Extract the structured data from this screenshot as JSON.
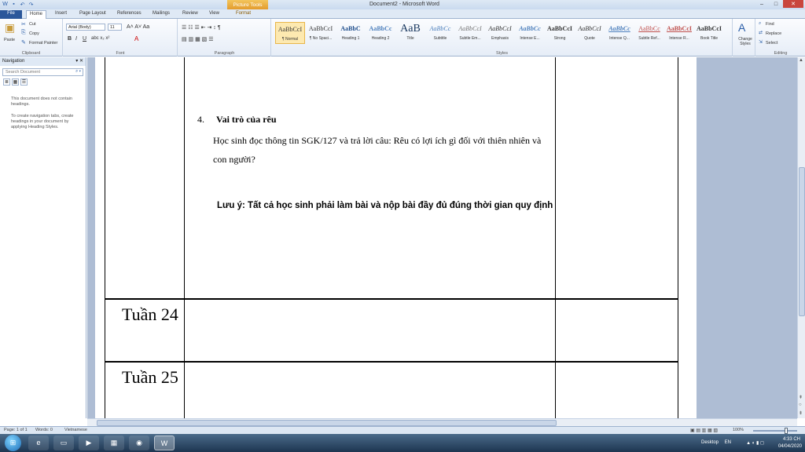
{
  "app": {
    "window_title": "Document2 - Microsoft Word",
    "contextual_tab": "Picture Tools"
  },
  "tabs": [
    "File",
    "Home",
    "Insert",
    "Page Layout",
    "References",
    "Mailings",
    "Review",
    "View",
    "Format"
  ],
  "ribbon": {
    "clipboard": {
      "paste": "Paste",
      "cut": "Cut",
      "copy": "Copy",
      "format_painter": "Format Painter",
      "label": "Clipboard"
    },
    "font": {
      "name": "Arial (Body)",
      "size": "11",
      "label": "Font"
    },
    "paragraph": {
      "label": "Paragraph"
    },
    "styles": {
      "label": "Styles",
      "items": [
        {
          "sample": "AaBbCcI",
          "name": "¶ Normal"
        },
        {
          "sample": "AaBbCcI",
          "name": "¶ No Spaci..."
        },
        {
          "sample": "AaBbC",
          "name": "Heading 1"
        },
        {
          "sample": "AaBbCc",
          "name": "Heading 2"
        },
        {
          "sample": "AaB",
          "name": "Title"
        },
        {
          "sample": "AaBbCc",
          "name": "Subtitle"
        },
        {
          "sample": "AaBbCcI",
          "name": "Subtle Em..."
        },
        {
          "sample": "AaBbCcI",
          "name": "Emphasis"
        },
        {
          "sample": "AaBbCc",
          "name": "Intense E..."
        },
        {
          "sample": "AaBbCcI",
          "name": "Strong"
        },
        {
          "sample": "AaBbCcI",
          "name": "Quote"
        },
        {
          "sample": "AaBbCc",
          "name": "Intense Q..."
        },
        {
          "sample": "AaBbCc",
          "name": "Subtle Ref..."
        },
        {
          "sample": "AaBbCcI",
          "name": "Intense R..."
        },
        {
          "sample": "AaBbCcI",
          "name": "Book Title"
        }
      ],
      "change_styles": "Change Styles"
    },
    "editing": {
      "find": "Find",
      "replace": "Replace",
      "select": "Select",
      "label": "Editing"
    }
  },
  "navigation": {
    "title": "Navigation",
    "search_placeholder": "Search Document",
    "no_headings": "This document does not contain headings.",
    "help": "To create navigation tabs, create headings in your document by applying Heading Styles."
  },
  "document": {
    "heading_number": "4.",
    "heading": "Vai trò của rêu",
    "para_line1": "Học sinh đọc thông tin SGK/127 và trả lời câu: Rêu có lợi ích gì đối với thiên nhiên và",
    "para_line2": "con người?",
    "note": "Lưu ý: Tất cả học sinh phải làm bài và nộp bài đầy đủ đúng thời gian quy định",
    "week_24": "Tuần 24",
    "week_25": "Tuần 25"
  },
  "status": {
    "page": "Page: 1 of 1",
    "words": "Words: 0",
    "language": "Vietnamese",
    "zoom": "100%"
  },
  "taskbar": {
    "desktop": "Desktop",
    "lang": "EN",
    "time": "4:33 CH",
    "date": "04/04/2020"
  }
}
